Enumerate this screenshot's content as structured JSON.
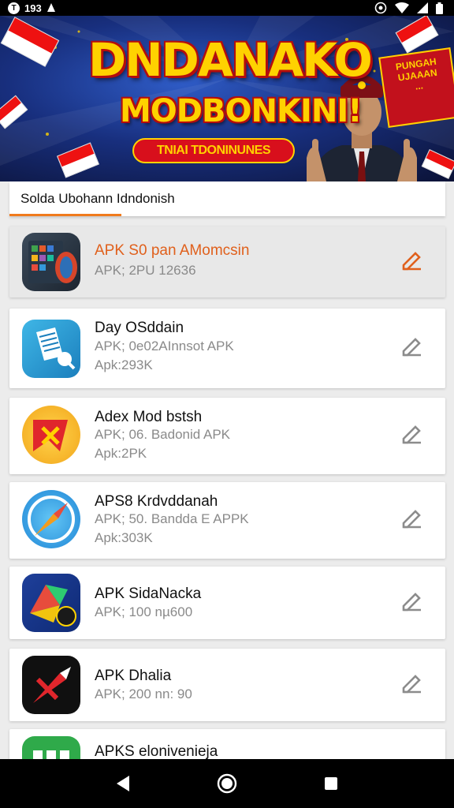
{
  "status_bar": {
    "time": "193",
    "badge": "T",
    "icons": [
      "notification-icon",
      "target-icon",
      "wifi-icon",
      "signal-icon",
      "battery-icon"
    ]
  },
  "banner": {
    "title": "DNDANAKO",
    "subtitle": "MODBONKINI!",
    "pill": "TNIAI TDONINUNES",
    "sign_lines": [
      "PUNGAH",
      "UJAAAN",
      "..."
    ],
    "colors": {
      "title": "#ffd200",
      "outline": "#b40d0d",
      "background": "#182f7e"
    }
  },
  "section": {
    "title": "Solda Ubohann Idndonish",
    "accent": "#f07b1d"
  },
  "apps": [
    {
      "name": "APK S0 pan AMomcsin",
      "meta": [
        "APK; 2PU 12636"
      ],
      "icon": "tablet-app-icon",
      "selected": true
    },
    {
      "name": "Day OSddain",
      "meta": [
        "APK; 0e02AInnsot APK",
        "Apk:293K"
      ],
      "icon": "document-app-icon",
      "selected": false
    },
    {
      "name": "Adex Mod bstsh",
      "meta": [
        "APK; 06. Badonid APK",
        "Apk:2PK"
      ],
      "icon": "flag-app-icon",
      "selected": false
    },
    {
      "name": "APS8 Krdvddanah",
      "meta": [
        "APK; 50. Bandda E APPK",
        "Apk:303K"
      ],
      "icon": "compass-app-icon",
      "selected": false
    },
    {
      "name": "APK SidaNacka",
      "meta": [
        "APK; 100 nµ600"
      ],
      "icon": "map-app-icon",
      "selected": false
    },
    {
      "name": "APK Dhalia",
      "meta": [
        "APK; 200 nn: 90"
      ],
      "icon": "arrow-app-icon",
      "selected": false
    },
    {
      "name": "APKS elonivenieja",
      "meta": [],
      "icon": "grid-app-icon",
      "selected": false
    }
  ],
  "nav": [
    "back-icon",
    "home-icon",
    "recents-icon"
  ]
}
